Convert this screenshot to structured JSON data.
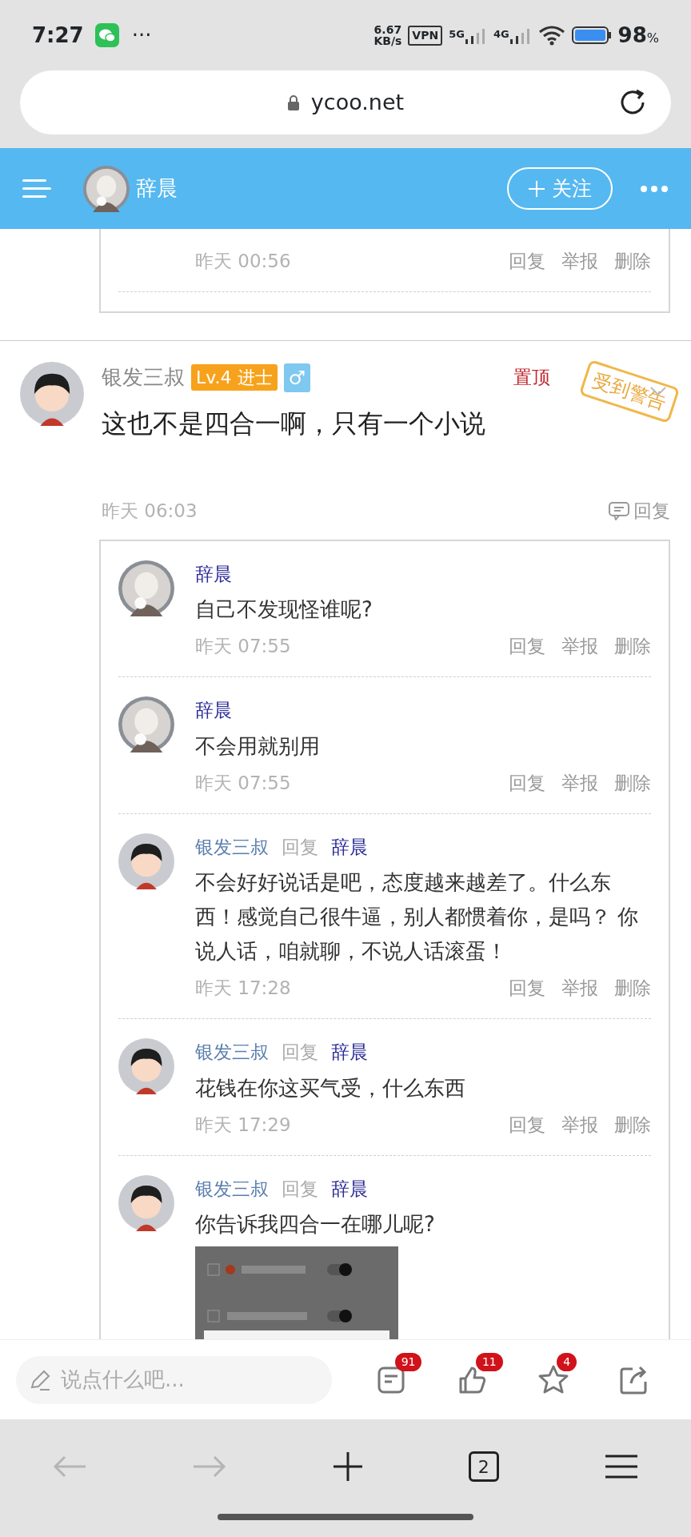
{
  "status_bar": {
    "time": "7:27",
    "more": "···",
    "speed_value": "6.67",
    "speed_unit": "KB/s",
    "vpn": "VPN",
    "net1": "5G",
    "net2": "4G",
    "battery": "98",
    "battery_unit": "%"
  },
  "address_bar": {
    "url": "ycoo.net"
  },
  "header": {
    "name": "辞晨",
    "follow": "关注"
  },
  "previous_reply": {
    "time": "昨天 00:56",
    "actions": [
      "回复",
      "举报",
      "删除"
    ]
  },
  "comment": {
    "author": "银发三叔",
    "level": "Lv.4 进士",
    "gender": "♂",
    "pin": "置顶",
    "stamp": "受到警告",
    "text": "这也不是四合一啊，只有一个小说",
    "time": "昨天 06:03",
    "reply": "回复",
    "replies": [
      {
        "author": "辞晨",
        "color": "#2a2a96",
        "text": "自己不发现怪谁呢?",
        "time": "昨天 07:55",
        "actions": [
          "回复",
          "举报",
          "删除"
        ]
      },
      {
        "author": "辞晨",
        "color": "#2a2a96",
        "text": "不会用就别用",
        "time": "昨天 07:55",
        "actions": [
          "回复",
          "举报",
          "删除"
        ]
      },
      {
        "author": "银发三叔",
        "color": "#5a7fae",
        "reply_word": "回复",
        "reply_to": "辞晨",
        "text": "不会好好说话是吧，态度越来越差了。什么东西！感觉自己很牛逼，别人都惯着你，是吗？ 你说人话，咱就聊，不说人话滚蛋！",
        "time": "昨天 17:28",
        "actions": [
          "回复",
          "举报",
          "删除"
        ]
      },
      {
        "author": "银发三叔",
        "color": "#5a7fae",
        "reply_word": "回复",
        "reply_to": "辞晨",
        "text": "花钱在你这买气受，什么东西",
        "time": "昨天 17:29",
        "actions": [
          "回复",
          "举报",
          "删除"
        ]
      },
      {
        "author": "银发三叔",
        "color": "#5a7fae",
        "reply_word": "回复",
        "reply_to": "辞晨",
        "text": "你告诉我四合一在哪儿呢?"
      }
    ]
  },
  "bottom_bar": {
    "placeholder": "说点什么吧...",
    "buttons": [
      {
        "kind": "comments",
        "count": "91"
      },
      {
        "kind": "likes",
        "count": "11"
      },
      {
        "kind": "favorites",
        "count": "4"
      },
      {
        "kind": "share"
      }
    ]
  },
  "browser_nav": {
    "tabs": "2",
    "back_disabled": true,
    "forward_disabled": true
  }
}
